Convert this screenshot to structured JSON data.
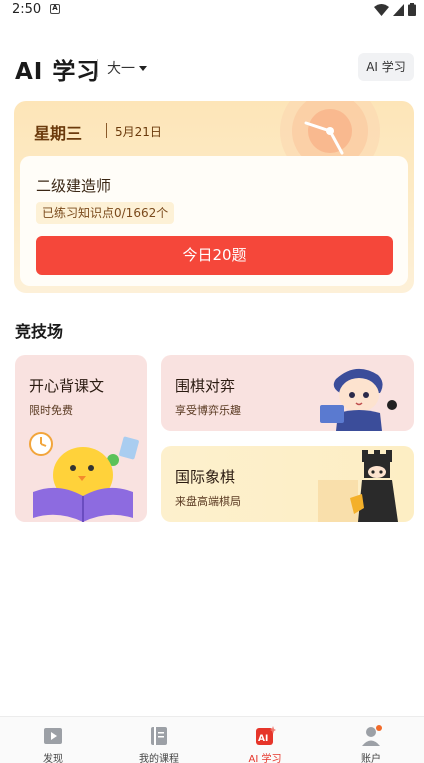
{
  "status_bar": {
    "time": "2:50",
    "notification_glyph": "A"
  },
  "header": {
    "title": "AI 学习",
    "grade": "大一",
    "ai_button": "AI 学习"
  },
  "daily": {
    "weekday": "星期三",
    "date": "5月21日",
    "exam_name": "二级建造师",
    "progress_text": "已练习知识点0/1662个",
    "today_button": "今日20题"
  },
  "arena": {
    "title": "竞技场",
    "tiles": [
      {
        "title": "开心背课文",
        "subtitle": "限时免费"
      },
      {
        "title": "围棋对弈",
        "subtitle": "享受博弈乐趣"
      },
      {
        "title": "国际象棋",
        "subtitle": "来盘高端棋局"
      }
    ]
  },
  "nav": {
    "items": [
      {
        "label": "发现",
        "icon": "video-icon"
      },
      {
        "label": "我的课程",
        "icon": "book-icon"
      },
      {
        "label": "AI 学习",
        "icon": "ai-icon"
      },
      {
        "label": "账户",
        "icon": "user-icon"
      }
    ],
    "active_index": 2
  },
  "colors": {
    "accent": "#f5473a",
    "card_bg": "#fde5b8",
    "tile_pink": "#f9e2e0",
    "tile_yellow": "#fdf0cd"
  }
}
